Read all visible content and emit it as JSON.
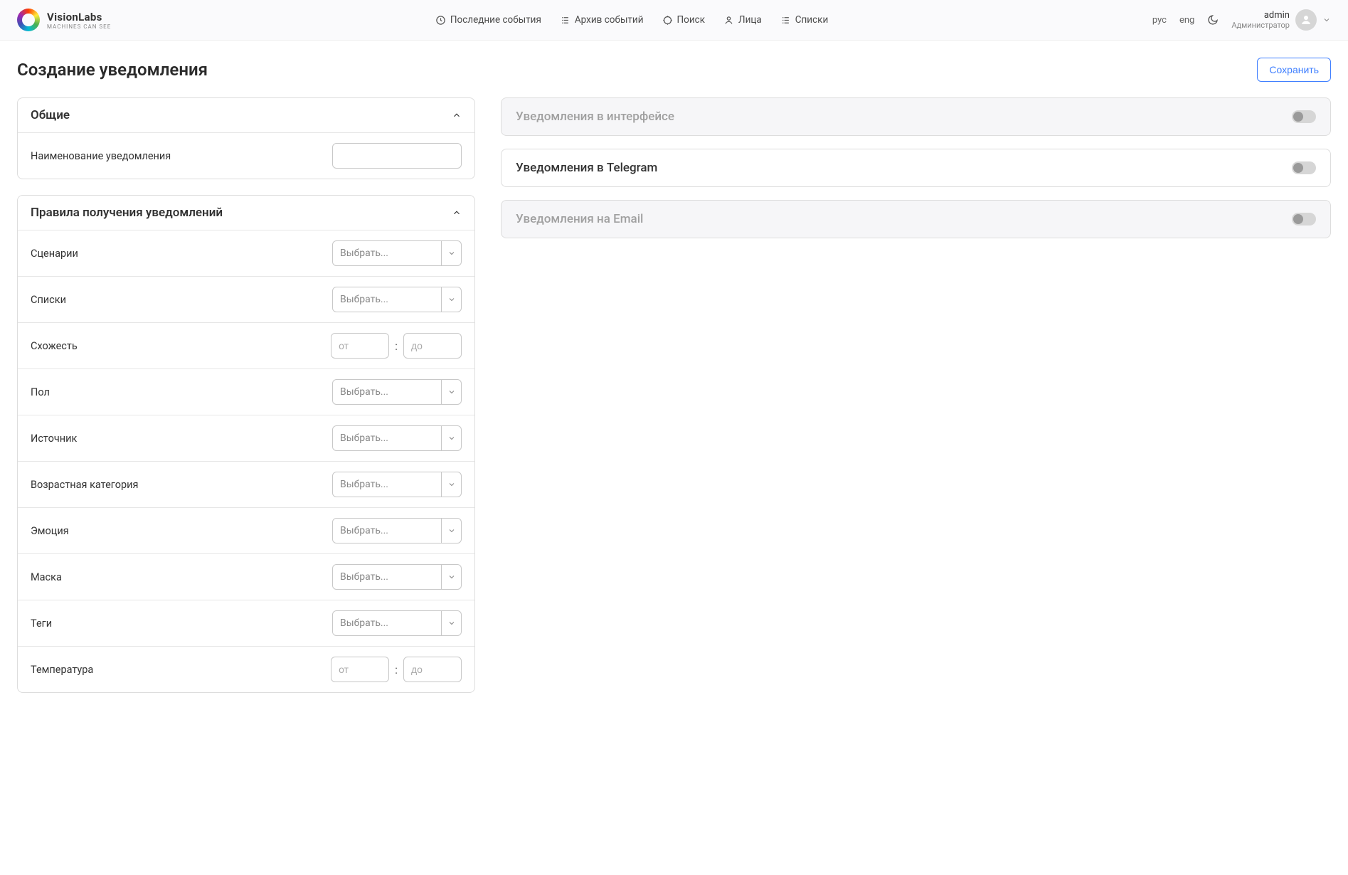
{
  "brand": {
    "name": "VisionLabs",
    "tag": "MACHINES CAN SEE"
  },
  "nav": {
    "recent": "Последние события",
    "archive": "Архив событий",
    "search": "Поиск",
    "faces": "Лица",
    "lists": "Списки"
  },
  "lang": {
    "rus": "рус",
    "eng": "eng"
  },
  "user": {
    "name": "admin",
    "role": "Администратор"
  },
  "page": {
    "title": "Создание уведомления",
    "save": "Сохранить"
  },
  "general": {
    "header": "Общие",
    "name_label": "Наименование уведомления"
  },
  "rules": {
    "header": "Правила получения уведомлений",
    "select_placeholder": "Выбрать...",
    "from_ph": "от",
    "to_ph": "до",
    "fields": {
      "scenarios": "Сценарии",
      "lists": "Списки",
      "similarity": "Схожесть",
      "gender": "Пол",
      "source": "Источник",
      "age": "Возрастная категория",
      "emotion": "Эмоция",
      "mask": "Маска",
      "tags": "Теги",
      "temperature": "Температура"
    }
  },
  "channels": {
    "ui": "Уведомления в интерфейсе",
    "telegram": "Уведомления в Telegram",
    "email": "Уведомления на Email"
  }
}
